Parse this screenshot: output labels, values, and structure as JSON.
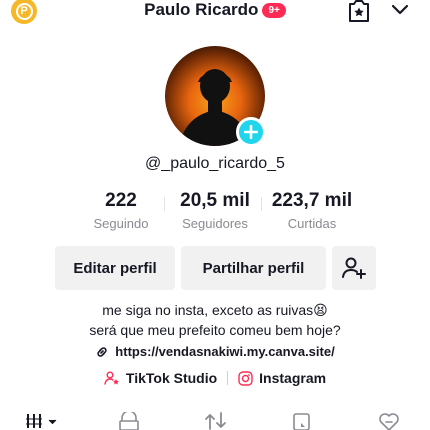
{
  "header": {
    "title": "Paulo Ricardo",
    "notification_badge": "9+",
    "p_badge_letter": "P",
    "icons": [
      "p-badge-icon",
      "favorites-icon",
      "chevron-down-icon"
    ]
  },
  "profile": {
    "username": "@_paulo_ricardo_5",
    "avatar_icon": "avatar",
    "add_icon": "plus-icon"
  },
  "stats": [
    {
      "value": "222",
      "label": "Seguindo"
    },
    {
      "value": "20,5 mil",
      "label": "Seguidores"
    },
    {
      "value": "223,7 mil",
      "label": "Curtidas"
    }
  ],
  "actions": {
    "edit_label": "Editar perfil",
    "share_label": "Partilhar perfil",
    "add_friend_icon": "add-friend-icon"
  },
  "bio": {
    "line1": "me siga no insta, exceto as ruivas😫",
    "line2": "será que meu prefeito comeu bem hoje?"
  },
  "link": {
    "url": "https://vendasnakiwi.my.canva.site/"
  },
  "socials": {
    "tiktok_studio": "TikTok Studio",
    "instagram": "Instagram"
  },
  "tabs": [
    "grid-icon",
    "lock-icon",
    "repost-icon",
    "saved-icon",
    "liked-icon"
  ],
  "colors": {
    "accent": "#fe2c55",
    "plus_button": "#20d5ec",
    "p_badge": "#f6b828"
  }
}
